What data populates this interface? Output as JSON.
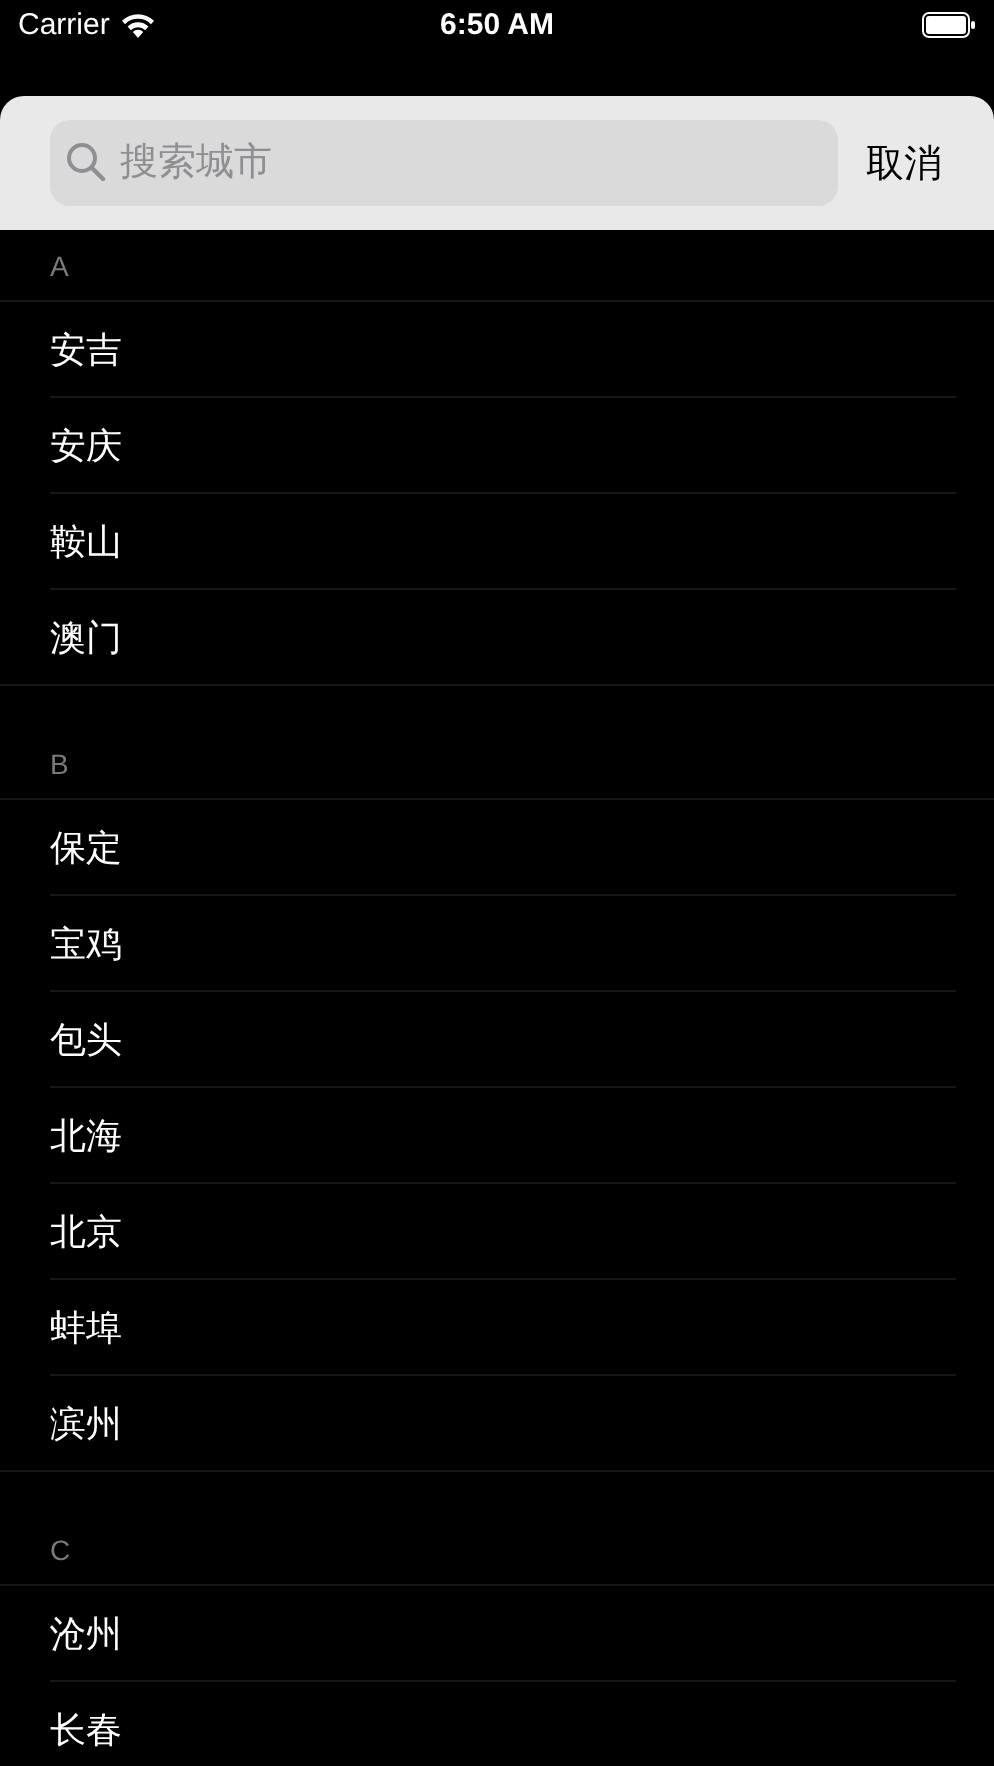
{
  "status_bar": {
    "carrier": "Carrier",
    "time": "6:50 AM"
  },
  "search": {
    "placeholder": "搜索城市",
    "cancel": "取消"
  },
  "sections": [
    {
      "letter": "A",
      "cities": [
        "安吉",
        "安庆",
        "鞍山",
        "澳门"
      ]
    },
    {
      "letter": "B",
      "cities": [
        "保定",
        "宝鸡",
        "包头",
        "北海",
        "北京",
        "蚌埠",
        "滨州"
      ]
    },
    {
      "letter": "C",
      "cities": [
        "沧州",
        "长春"
      ]
    }
  ]
}
